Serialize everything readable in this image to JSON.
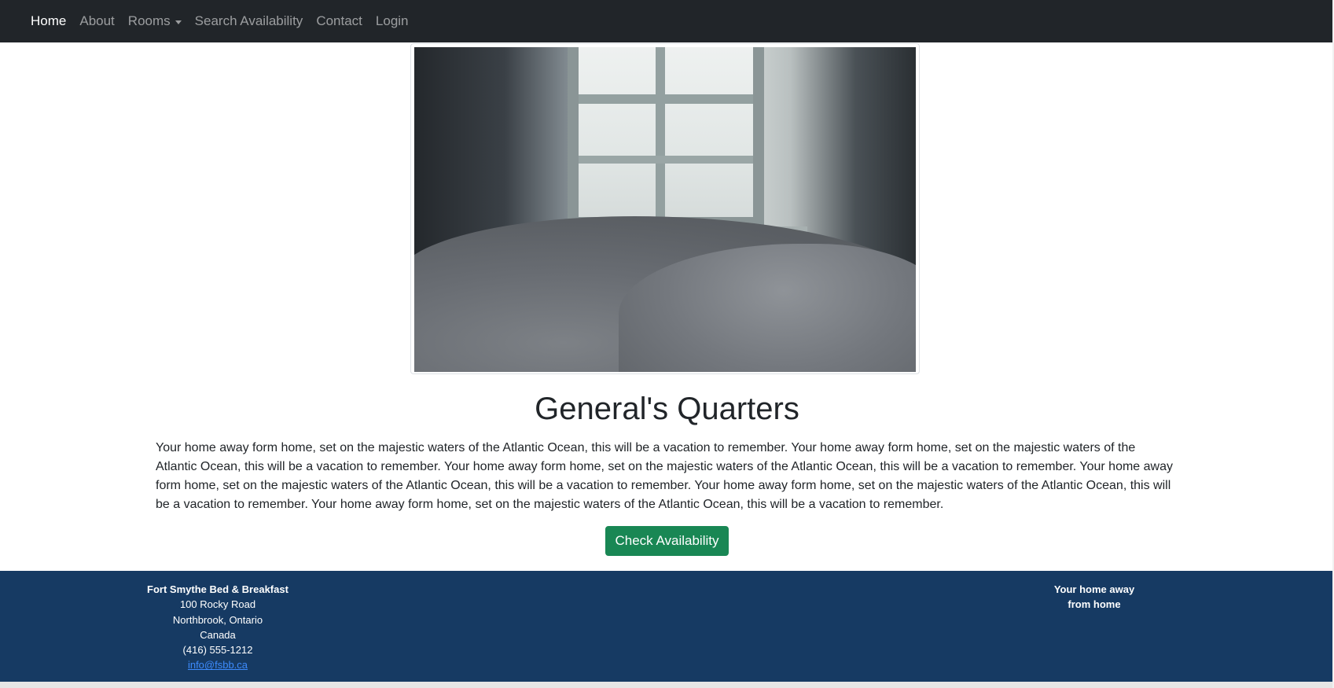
{
  "navbar": {
    "items": [
      {
        "label": "Home",
        "active": true
      },
      {
        "label": "About",
        "active": false
      },
      {
        "label": "Rooms",
        "active": false,
        "dropdown": true
      },
      {
        "label": "Search Availability",
        "active": false
      },
      {
        "label": "Contact",
        "active": false
      },
      {
        "label": "Login",
        "active": false
      }
    ]
  },
  "room": {
    "title": "General's Quarters",
    "description": "Your home away form home, set on the majestic waters of the Atlantic Ocean, this will be a vacation to remember. Your home away form home, set on the majestic waters of the Atlantic Ocean, this will be a vacation to remember. Your home away form home, set on the majestic waters of the Atlantic Ocean, this will be a vacation to remember. Your home away form home, set on the majestic waters of the Atlantic Ocean, this will be a vacation to remember. Your home away form home, set on the majestic waters of the Atlantic Ocean, this will be a vacation to remember. Your home away form home, set on the majestic waters of the Atlantic Ocean, this will be a vacation to remember.",
    "button_label": "Check Availability"
  },
  "footer": {
    "business_name": "Fort Smythe Bed & Breakfast",
    "address_line1": "100 Rocky Road",
    "address_line2": "Northbrook, Ontario",
    "country": "Canada",
    "phone": "(416) 555-1212",
    "email": "info@fsbb.ca",
    "tagline_line1": "Your home away",
    "tagline_line2": "from home"
  },
  "colors": {
    "navbar_bg": "#212529",
    "button_bg": "#198754",
    "footer_bg": "#163a63",
    "link": "#3d8bfd"
  }
}
